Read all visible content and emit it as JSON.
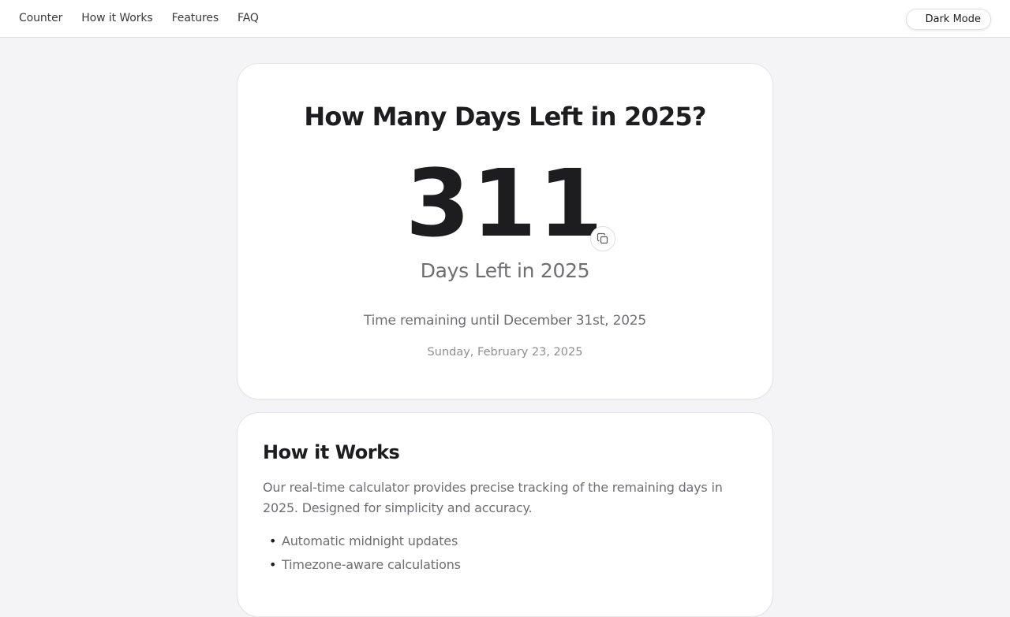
{
  "nav": {
    "links": [
      "Counter",
      "How it Works",
      "Features",
      "FAQ"
    ],
    "dark_mode_label": "Dark Mode"
  },
  "counter": {
    "title": "How Many Days Left in 2025?",
    "days_left": "311",
    "days_label": "Days Left in 2025",
    "remaining_text": "Time remaining until December 31st, 2025",
    "current_date": "Sunday, February 23, 2025",
    "copy_icon": "copy-icon"
  },
  "how_it_works": {
    "title": "How it Works",
    "description": "Our real-time calculator provides precise tracking of the remaining days in 2025. Designed for simplicity and accuracy.",
    "items": [
      "Automatic midnight updates",
      "Timezone-aware calculations"
    ]
  },
  "colors": {
    "background": "#f4f4f6",
    "card": "#ffffff",
    "text_primary": "#1d1d1f",
    "text_secondary": "#6e6e73"
  }
}
